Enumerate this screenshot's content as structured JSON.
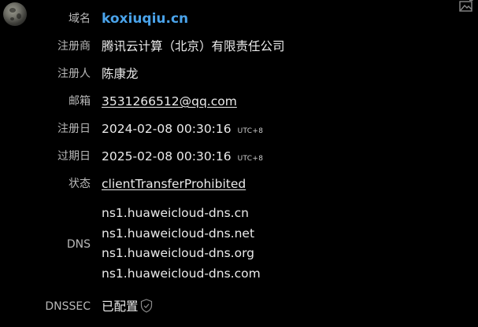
{
  "whois": {
    "domain": {
      "label": "域名",
      "value": "koxiuqiu.cn"
    },
    "registrar": {
      "label": "注册商",
      "value": "腾讯云计算（北京）有限责任公司"
    },
    "registrant": {
      "label": "注册人",
      "value": "陈康龙"
    },
    "email": {
      "label": "邮箱",
      "value": "3531266512@qq.com"
    },
    "created": {
      "label": "注册日",
      "value": "2024-02-08 00:30:16",
      "tz": "UTC+8"
    },
    "expires": {
      "label": "过期日",
      "value": "2025-02-08 00:30:16",
      "tz": "UTC+8"
    },
    "status": {
      "label": "状态",
      "value": "clientTransferProhibited"
    },
    "dns": {
      "label": "DNS",
      "servers": [
        "ns1.huaweicloud-dns.cn",
        "ns1.huaweicloud-dns.net",
        "ns1.huaweicloud-dns.org",
        "ns1.huaweicloud-dns.com"
      ]
    },
    "dnssec": {
      "label": "DNSSEC",
      "value": "已配置"
    }
  },
  "icons": {
    "avatar": "moon-avatar",
    "top_right": "image-icon",
    "dnssec": "shield-icon"
  },
  "colors": {
    "background": "#000000",
    "domain_accent": "#4aa3ea",
    "label": "#b9b9b9",
    "value": "#ebebeb"
  }
}
